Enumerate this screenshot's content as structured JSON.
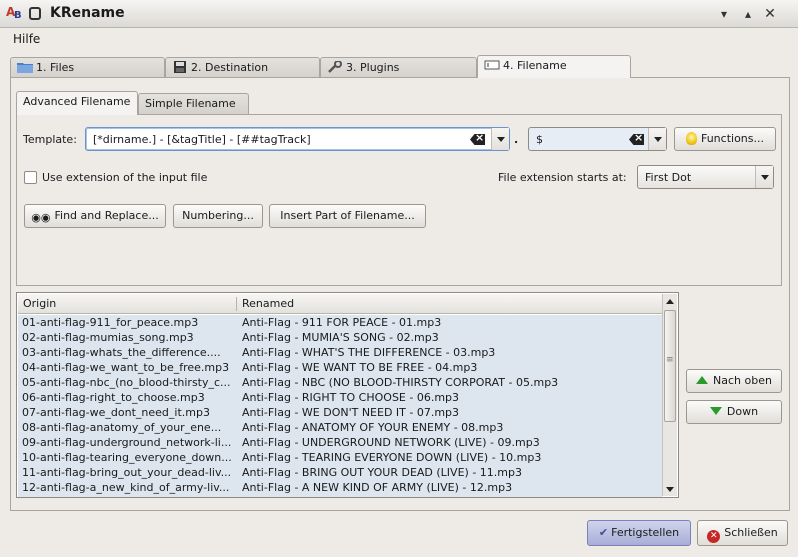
{
  "window": {
    "title": "KRename",
    "app_icon_letters": "AB"
  },
  "menu": {
    "help": "Hilfe"
  },
  "main_tabs": [
    {
      "num": "1.",
      "label": "Files",
      "icon": "folder-icon"
    },
    {
      "num": "2.",
      "label": "Destination",
      "icon": "floppy-icon"
    },
    {
      "num": "3.",
      "label": "Plugins",
      "icon": "wrench-icon"
    },
    {
      "num": "4.",
      "label": "Filename",
      "icon": "textfield-icon"
    }
  ],
  "sub_tabs": [
    "Advanced Filename",
    "Simple Filename"
  ],
  "template": {
    "label": "Template:",
    "value": "[*dirname.] - [&tagTitle] - [##tagTrack]",
    "separator": ".",
    "extension_value": "$"
  },
  "functions_button": "Functions...",
  "use_extension_label": "Use extension of the input file",
  "use_extension_checked": false,
  "extension_starts": {
    "label": "File extension starts at:",
    "value": "First Dot"
  },
  "buttons": {
    "find_replace": "Find and Replace...",
    "numbering": "Numbering...",
    "insert_part": "Insert Part of Filename..."
  },
  "list": {
    "columns": [
      "Origin",
      "Renamed"
    ],
    "rows": [
      [
        "01-anti-flag-911_for_peace.mp3",
        "Anti-Flag - 911 FOR PEACE - 01.mp3"
      ],
      [
        "02-anti-flag-mumias_song.mp3",
        "Anti-Flag - MUMIA'S SONG - 02.mp3"
      ],
      [
        "03-anti-flag-whats_the_difference....",
        "Anti-Flag - WHAT'S THE DIFFERENCE - 03.mp3"
      ],
      [
        "04-anti-flag-we_want_to_be_free.mp3",
        "Anti-Flag - WE WANT TO BE FREE - 04.mp3"
      ],
      [
        "05-anti-flag-nbc_(no_blood-thirsty_c...",
        "Anti-Flag - NBC (NO BLOOD-THIRSTY CORPORAT - 05.mp3"
      ],
      [
        "06-anti-flag-right_to_choose.mp3",
        "Anti-Flag - RIGHT TO CHOOSE - 06.mp3"
      ],
      [
        "07-anti-flag-we_dont_need_it.mp3",
        "Anti-Flag - WE DON'T NEED IT - 07.mp3"
      ],
      [
        "08-anti-flag-anatomy_of_your_ene...",
        "Anti-Flag - ANATOMY OF YOUR ENEMY - 08.mp3"
      ],
      [
        "09-anti-flag-underground_network-li...",
        "Anti-Flag - UNDERGROUND NETWORK (LIVE) - 09.mp3"
      ],
      [
        "10-anti-flag-tearing_everyone_down...",
        "Anti-Flag - TEARING EVERYONE DOWN (LIVE) - 10.mp3"
      ],
      [
        "11-anti-flag-bring_out_your_dead-liv...",
        "Anti-Flag - BRING OUT YOUR DEAD (LIVE) - 11.mp3"
      ],
      [
        "12-anti-flag-a_new_kind_of_army-liv...",
        "Anti-Flag - A NEW KIND OF ARMY (LIVE) - 12.mp3"
      ]
    ]
  },
  "side_buttons": {
    "up": "Nach oben",
    "down": "Down"
  },
  "footer": {
    "finish": "Fertigstellen",
    "close": "Schließen"
  },
  "colors": {
    "accent": "#a8afd8",
    "list_bg": "#dde6ef",
    "arrow_green": "#2a9a2a",
    "close_red": "#c62828"
  }
}
